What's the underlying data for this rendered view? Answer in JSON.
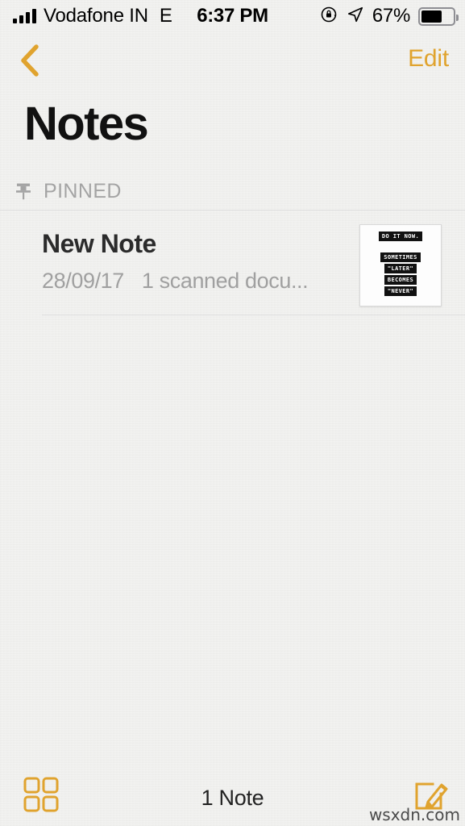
{
  "status_bar": {
    "carrier": "Vodafone IN",
    "network_type": "E",
    "time": "6:37 PM",
    "battery_percent": "67%",
    "battery_level": 67,
    "signal_bars": 4,
    "icons": [
      "signal-bars-icon",
      "rotation-lock-icon",
      "location-arrow-icon",
      "battery-icon"
    ]
  },
  "nav_bar": {
    "back_label": "",
    "edit_label": "Edit",
    "accent_color": "#e0a32e"
  },
  "header": {
    "title": "Notes"
  },
  "sections": [
    {
      "label": "PINNED",
      "icon": "pin-icon"
    }
  ],
  "notes": [
    {
      "title": "New Note",
      "date": "28/09/17",
      "preview": "1 scanned docu...",
      "thumbnail": {
        "lines": [
          "DO IT NOW.",
          "SOMETIMES",
          "\"LATER\"",
          "BECOMES",
          "\"NEVER\""
        ]
      }
    }
  ],
  "toolbar": {
    "grid_icon": "grid-view-icon",
    "count_label": "1 Note",
    "compose_icon": "compose-note-icon"
  },
  "watermark": {
    "text": "wsxdn.com"
  }
}
